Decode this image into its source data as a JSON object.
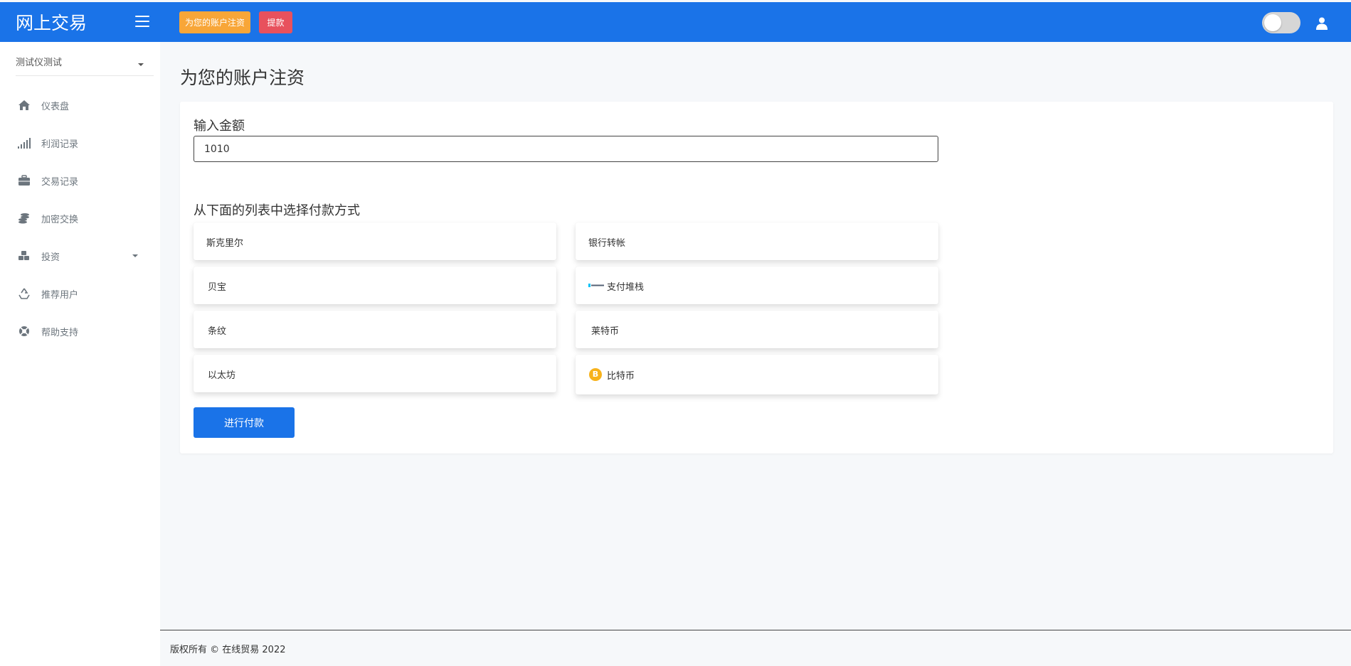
{
  "header": {
    "brand": "网上交易",
    "deposit_button": "为您的账户注资",
    "withdraw_button": "提款",
    "primary_color": "#1a73e8",
    "deposit_color": "#f8a638",
    "withdraw_color": "#e8515d"
  },
  "sidebar": {
    "account_select": "测试仪测试",
    "items": [
      {
        "label": "仪表盘",
        "icon": "home-icon"
      },
      {
        "label": "利润记录",
        "icon": "signal-bars-icon"
      },
      {
        "label": "交易记录",
        "icon": "briefcase-icon"
      },
      {
        "label": "加密交换",
        "icon": "coins-icon"
      },
      {
        "label": "投资",
        "icon": "cubes-icon"
      },
      {
        "label": "推荐用户",
        "icon": "recycle-icon"
      },
      {
        "label": "帮助支持",
        "icon": "lifebuoy-icon"
      }
    ]
  },
  "main": {
    "title": "为您的账户注资",
    "amount_label": "输入金额",
    "amount_value": "1010",
    "methods_label": "从下面的列表中选择付款方式",
    "methods": [
      {
        "label": "斯克里尔"
      },
      {
        "label": "银行转帐"
      },
      {
        "label": "贝宝"
      },
      {
        "label": "支付堆栈",
        "icon": "paystack-logo"
      },
      {
        "label": "条纹"
      },
      {
        "label": "莱特币"
      },
      {
        "label": "以太坊"
      },
      {
        "label": "比特币",
        "icon": "bitcoin-icon"
      }
    ],
    "pay_button": "进行付款"
  },
  "footer": {
    "copyright": "版权所有 © 在线贸易 2022"
  }
}
